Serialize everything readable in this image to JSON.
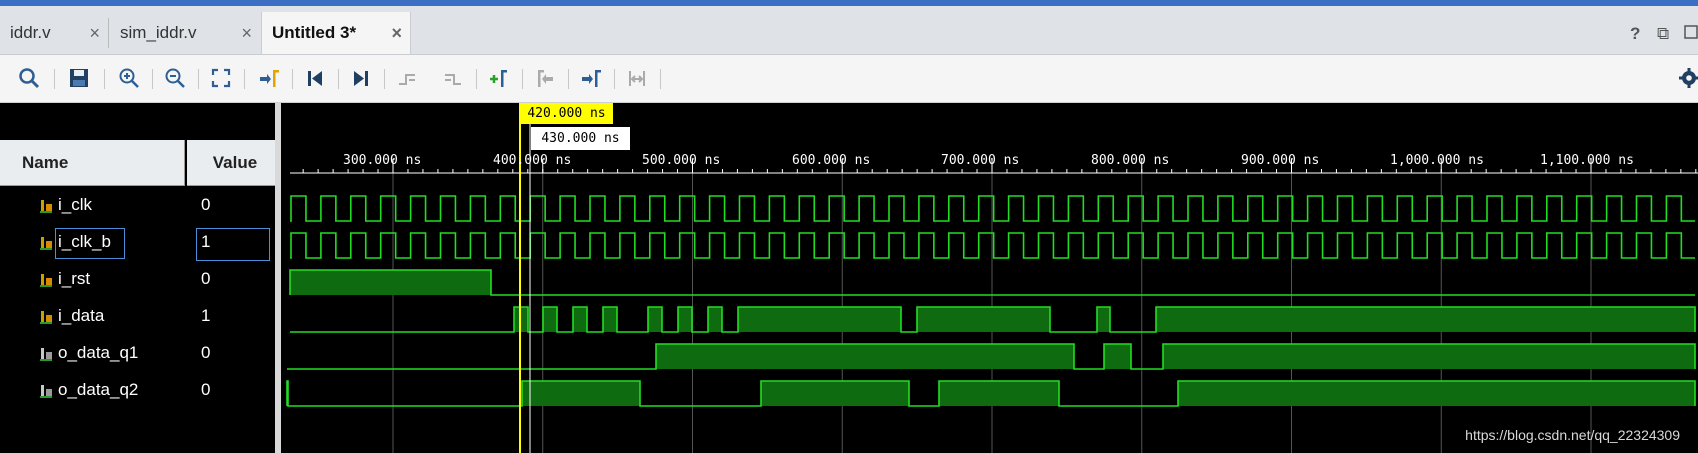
{
  "tabs": [
    {
      "label": "iddr.v",
      "close": "×",
      "active": false
    },
    {
      "label": "sim_iddr.v",
      "close": "×",
      "active": false
    },
    {
      "label": "Untitled 3*",
      "close": "×",
      "active": true
    }
  ],
  "window_buttons": {
    "help": "?",
    "restore": "⧉"
  },
  "toolbar_icons": [
    "search-icon",
    "save-icon",
    "zoom-in-icon",
    "zoom-out-icon",
    "zoom-fit-icon",
    "go-to-cursor-icon",
    "go-to-time-zero-icon",
    "go-to-last-time-icon",
    "previous-transition-icon",
    "next-transition-icon",
    "add-marker-icon",
    "previous-marker-icon",
    "next-marker-icon",
    "swap-cursors-icon",
    "settings-icon"
  ],
  "columns": {
    "name": "Name",
    "value": "Value"
  },
  "signals": [
    {
      "name": "i_clk",
      "value": "0"
    },
    {
      "name": "i_clk_b",
      "value": "1"
    },
    {
      "name": "i_rst",
      "value": "0"
    },
    {
      "name": "i_data",
      "value": "1"
    },
    {
      "name": "o_data_q1",
      "value": "0"
    },
    {
      "name": "o_data_q2",
      "value": "0"
    }
  ],
  "cursor": {
    "primary": "420.000 ns",
    "secondary": "430.000 ns"
  },
  "time_axis": [
    "300.000 ns",
    "400.000 ns",
    "500.000 ns",
    "600.000 ns",
    "700.000 ns",
    "800.000 ns",
    "900.000 ns",
    "1,000.000 ns",
    "1,100.000 ns"
  ],
  "watermark": "https://blog.csdn.net/qq_22324309",
  "colors": {
    "wave": "#22dd22",
    "wave_fill": "#0f6b0f",
    "cursor": "#ffff00",
    "background": "#000000"
  }
}
